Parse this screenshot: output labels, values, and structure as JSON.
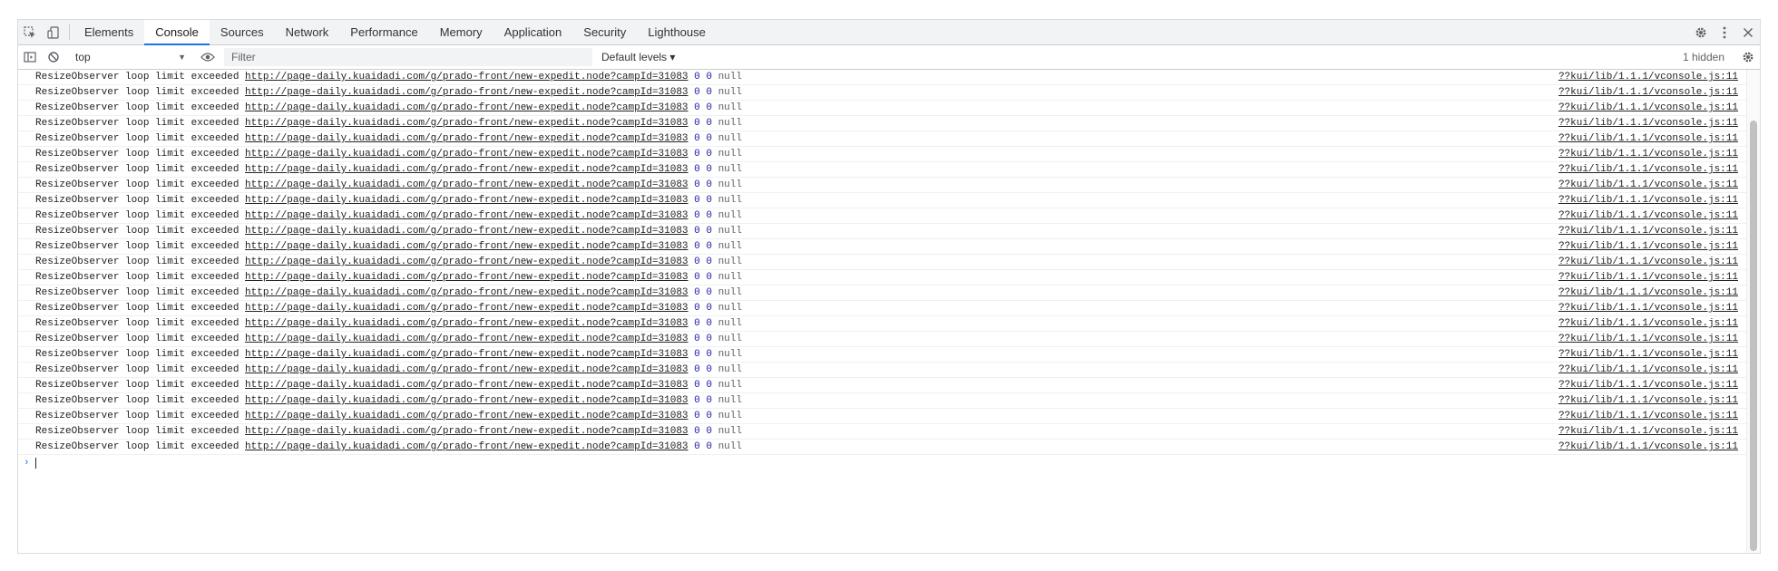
{
  "tabs": [
    {
      "label": "Elements",
      "active": false
    },
    {
      "label": "Console",
      "active": true
    },
    {
      "label": "Sources",
      "active": false
    },
    {
      "label": "Network",
      "active": false
    },
    {
      "label": "Performance",
      "active": false
    },
    {
      "label": "Memory",
      "active": false
    },
    {
      "label": "Application",
      "active": false
    },
    {
      "label": "Security",
      "active": false
    },
    {
      "label": "Lighthouse",
      "active": false
    }
  ],
  "toolbar": {
    "context": "top",
    "filter_placeholder": "Filter",
    "levels": "Default levels ▾",
    "hidden": "1 hidden"
  },
  "messages": {
    "text": "ResizeObserver loop limit exceeded",
    "url": "http://page-daily.kuaidadi.com/g/prado-front/new-expedit.node?campId=31083",
    "num1": "0",
    "num2": "0",
    "nullv": "null",
    "source": "??kui/lib/1.1.1/vconsole.js:11",
    "count": 25
  },
  "prompt": "›",
  "colors": {
    "accent": "#1a73e8",
    "number": "#1a1aa6"
  }
}
